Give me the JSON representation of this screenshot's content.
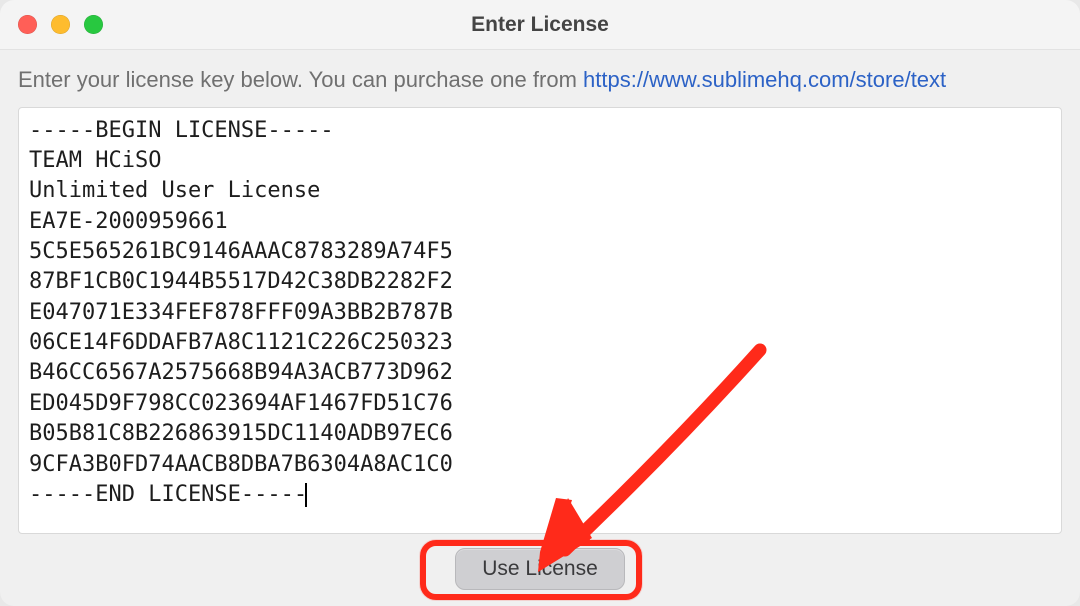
{
  "window": {
    "title": "Enter License"
  },
  "prompt": {
    "text_prefix": "Enter your license key below. You can purchase one from ",
    "link_text": "https://www.sublimehq.com/store/text"
  },
  "license": {
    "content": "-----BEGIN LICENSE-----\nTEAM HCiSO\nUnlimited User License\nEA7E-2000959661\n5C5E565261BC9146AAAC8783289A74F5\n87BF1CB0C1944B5517D42C38DB2282F2\nE047071E334FEF878FFF09A3BB2B787B\n06CE14F6DDAFB7A8C1121C226C250323\nB46CC6567A2575668B94A3ACB773D962\nED045D9F798CC023694AF1467FD51C76\nB05B81C8B226863915DC1140ADB97EC6\n9CFA3B0FD74AACB8DBA7B6304A8AC1C0\n-----END LICENSE-----"
  },
  "buttons": {
    "use_license": "Use License"
  },
  "annotation": {
    "arrow_color": "#ff2a1a"
  }
}
